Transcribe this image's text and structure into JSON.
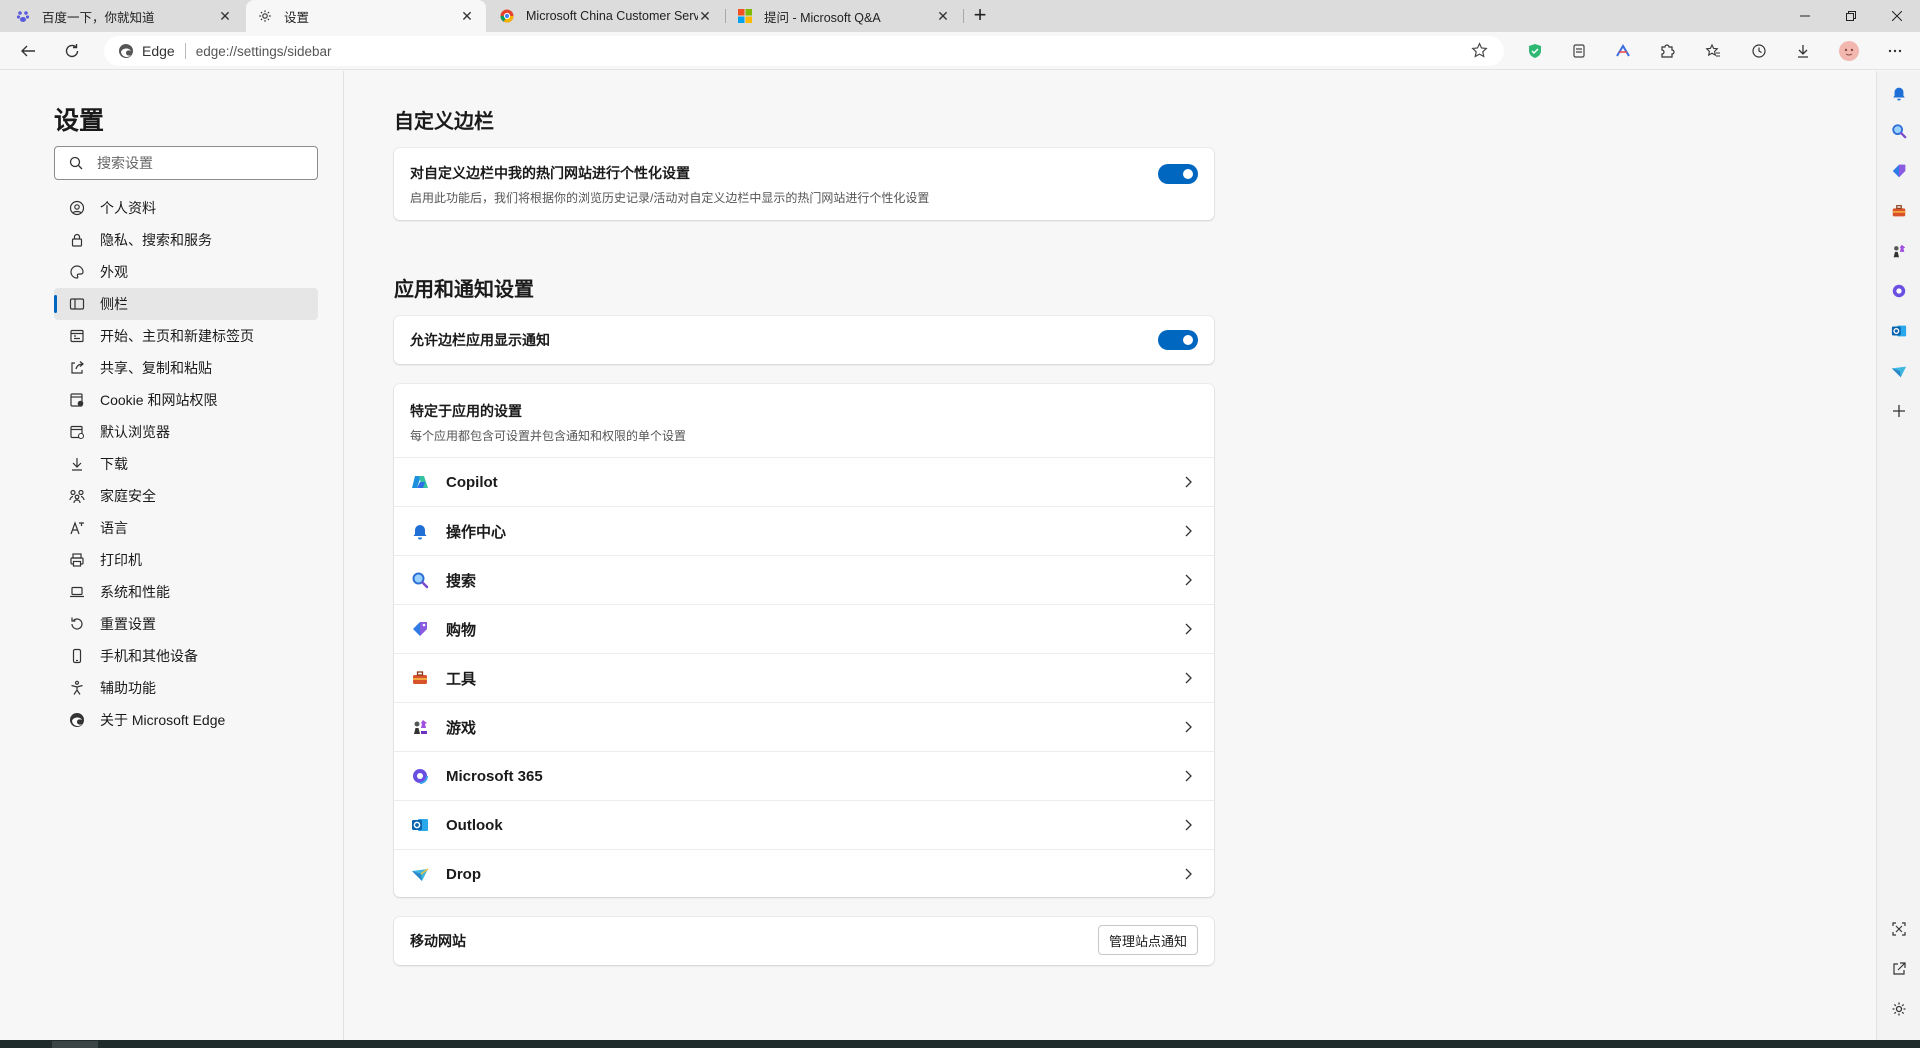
{
  "tabs": [
    {
      "title": "百度一下，你就知道",
      "favicon": "baidu-icon",
      "active": false
    },
    {
      "title": "设置",
      "favicon": "gear-icon",
      "active": true
    },
    {
      "title": "Microsoft China Customer Servic",
      "favicon": "chrome-colored-icon",
      "active": false
    },
    {
      "title": "提问 - Microsoft Q&A",
      "favicon": "microsoft-logo-icon",
      "active": false
    }
  ],
  "address": {
    "browser_label": "Edge",
    "url": "edge://settings/sidebar"
  },
  "nav": {
    "title": "设置",
    "search_placeholder": "搜索设置",
    "items": [
      {
        "label": "个人资料",
        "icon": "profile-icon"
      },
      {
        "label": "隐私、搜索和服务",
        "icon": "lock-icon"
      },
      {
        "label": "外观",
        "icon": "palette-icon"
      },
      {
        "label": "侧栏",
        "icon": "sidebar-icon"
      },
      {
        "label": "开始、主页和新建标签页",
        "icon": "home-page-icon"
      },
      {
        "label": "共享、复制和粘贴",
        "icon": "share-icon"
      },
      {
        "label": "Cookie 和网站权限",
        "icon": "cookie-icon"
      },
      {
        "label": "默认浏览器",
        "icon": "browser-icon"
      },
      {
        "label": "下载",
        "icon": "download-icon"
      },
      {
        "label": "家庭安全",
        "icon": "family-icon"
      },
      {
        "label": "语言",
        "icon": "language-icon"
      },
      {
        "label": "打印机",
        "icon": "printer-icon"
      },
      {
        "label": "系统和性能",
        "icon": "laptop-icon"
      },
      {
        "label": "重置设置",
        "icon": "reset-icon"
      },
      {
        "label": "手机和其他设备",
        "icon": "phone-icon"
      },
      {
        "label": "辅助功能",
        "icon": "accessibility-icon"
      },
      {
        "label": "关于 Microsoft Edge",
        "icon": "edge-logo-icon"
      }
    ],
    "active_index": 3
  },
  "sections": {
    "customize": {
      "title": "自定义边栏",
      "personalize_label": "对自定义边栏中我的热门网站进行个性化设置",
      "personalize_desc": "启用此功能后，我们将根据你的浏览历史记录/活动对自定义边栏中显示的热门网站进行个性化设置"
    },
    "apps": {
      "title": "应用和通知设置",
      "allow_notify_label": "允许边栏应用显示通知",
      "specific_label": "特定于应用的设置",
      "specific_desc": "每个应用都包含可设置并包含通知和权限的单个设置",
      "items": [
        {
          "label": "Copilot",
          "icon": "copilot-icon"
        },
        {
          "label": "操作中心",
          "icon": "bell-icon"
        },
        {
          "label": "搜索",
          "icon": "search-icon"
        },
        {
          "label": "购物",
          "icon": "shopping-tag-icon"
        },
        {
          "label": "工具",
          "icon": "toolbox-icon"
        },
        {
          "label": "游戏",
          "icon": "chess-icon"
        },
        {
          "label": "Microsoft 365",
          "icon": "m365-icon"
        },
        {
          "label": "Outlook",
          "icon": "outlook-icon"
        },
        {
          "label": "Drop",
          "icon": "drop-icon"
        }
      ]
    },
    "mobile": {
      "label": "移动网站",
      "button": "管理站点通知"
    }
  },
  "colors": {
    "accent": "#0067c0"
  }
}
